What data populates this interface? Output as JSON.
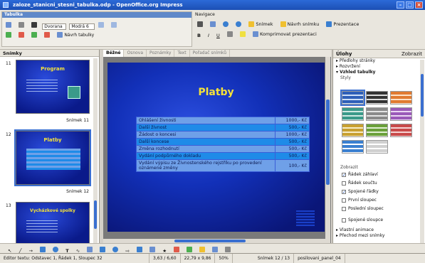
{
  "window": {
    "title": "zaloze_stanicni_stesni_tabulka.odp - OpenOffice.org Impress"
  },
  "toolbar": {
    "table_panel_label": "Tabulka",
    "font_name": "Dvorana",
    "font_size": "Modrá 6",
    "table_design_label": "Návrh tabulky",
    "navigation_label": "Navigace",
    "screenshot_label": "Snímek",
    "slide_design_label": "Návrh snímku",
    "presentation_label": "Prezentace",
    "compress_label": "Komprimovat prezentaci"
  },
  "slides_pane": {
    "header": "Snímky",
    "slides": [
      {
        "num": "11",
        "label": "Snímek 11",
        "title": "Program"
      },
      {
        "num": "12",
        "label": "Snímek 12",
        "title": "Platby"
      },
      {
        "num": "13",
        "label": "",
        "title": "Vycházkové spolky"
      }
    ]
  },
  "tabs": [
    "Běžné",
    "Osnova",
    "Poznámky",
    "Text",
    "Pořadač snímků"
  ],
  "slide": {
    "title": "Platby",
    "rows": [
      {
        "item": "Ohlášení živnosti",
        "amount": "1000,- Kč"
      },
      {
        "item": "Další živnost",
        "amount": "500,- Kč"
      },
      {
        "item": "Žádost o koncesi",
        "amount": "1000,- Kč"
      },
      {
        "item": "Další koncese",
        "amount": "500,- Kč"
      },
      {
        "item": "Změna rozhodnutí",
        "amount": "500,- Kč"
      },
      {
        "item": "Vydání podpůrného dokladu",
        "amount": "500,- Kč"
      },
      {
        "item": "Vydání výpisu ze Živnostenského rejstříku po provedení oznámené změny",
        "amount": "100,- Kč"
      }
    ]
  },
  "tasks_pane": {
    "header": "Úlohy",
    "view_label": "Zobrazit",
    "sections": [
      "Předlohy stránky",
      "Rozvržení",
      "Vzhled tabulky"
    ],
    "styles_label": "Styly",
    "show_label": "Zobrazit",
    "options": [
      {
        "label": "Řádek záhlaví",
        "checked": true
      },
      {
        "label": "Řádek součtu",
        "checked": false
      },
      {
        "label": "Spojené řádky",
        "checked": true
      },
      {
        "label": "První sloupec",
        "checked": false
      },
      {
        "label": "Poslední sloupec",
        "checked": false
      },
      {
        "label": "Spojené sloupce",
        "checked": false
      }
    ],
    "bottom_sections": [
      "Vlastní animace",
      "Přechod mezi snímky"
    ]
  },
  "statusbar": {
    "mode": "Editor textu: Odstavec 1, Řádek 1, Sloupec 32",
    "position": "3,63 / 6,60",
    "size": "22,79 x 9,86",
    "zoom": "50%",
    "slide": "Snímek 12 / 13",
    "layout": "posilovani_panel_04"
  },
  "colors": {
    "header_row": "#6fa0e8",
    "alt_row": "#1f8be8",
    "title_color": "#f5e23a"
  }
}
